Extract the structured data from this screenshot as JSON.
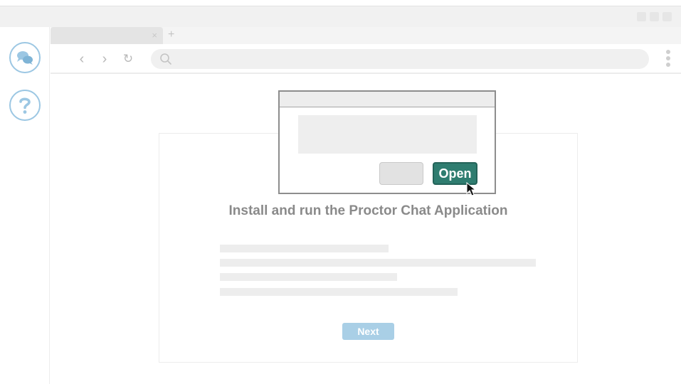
{
  "browser": {
    "tab_close": "×",
    "new_tab": "+",
    "nav": {
      "back": "‹",
      "forward": "›",
      "reload": "↻"
    }
  },
  "page": {
    "heading": "Install and run the Proctor Chat Application",
    "next_label": "Next"
  },
  "dialog": {
    "open_label": "Open"
  },
  "icons": {
    "chat": "chat-icon",
    "help": "help-icon",
    "search": "search-icon",
    "cursor": "mouse-cursor-icon"
  },
  "colors": {
    "accent": "#2f7d70",
    "side_icon": "#9cc7e3",
    "next_button": "#a9cfe6"
  }
}
